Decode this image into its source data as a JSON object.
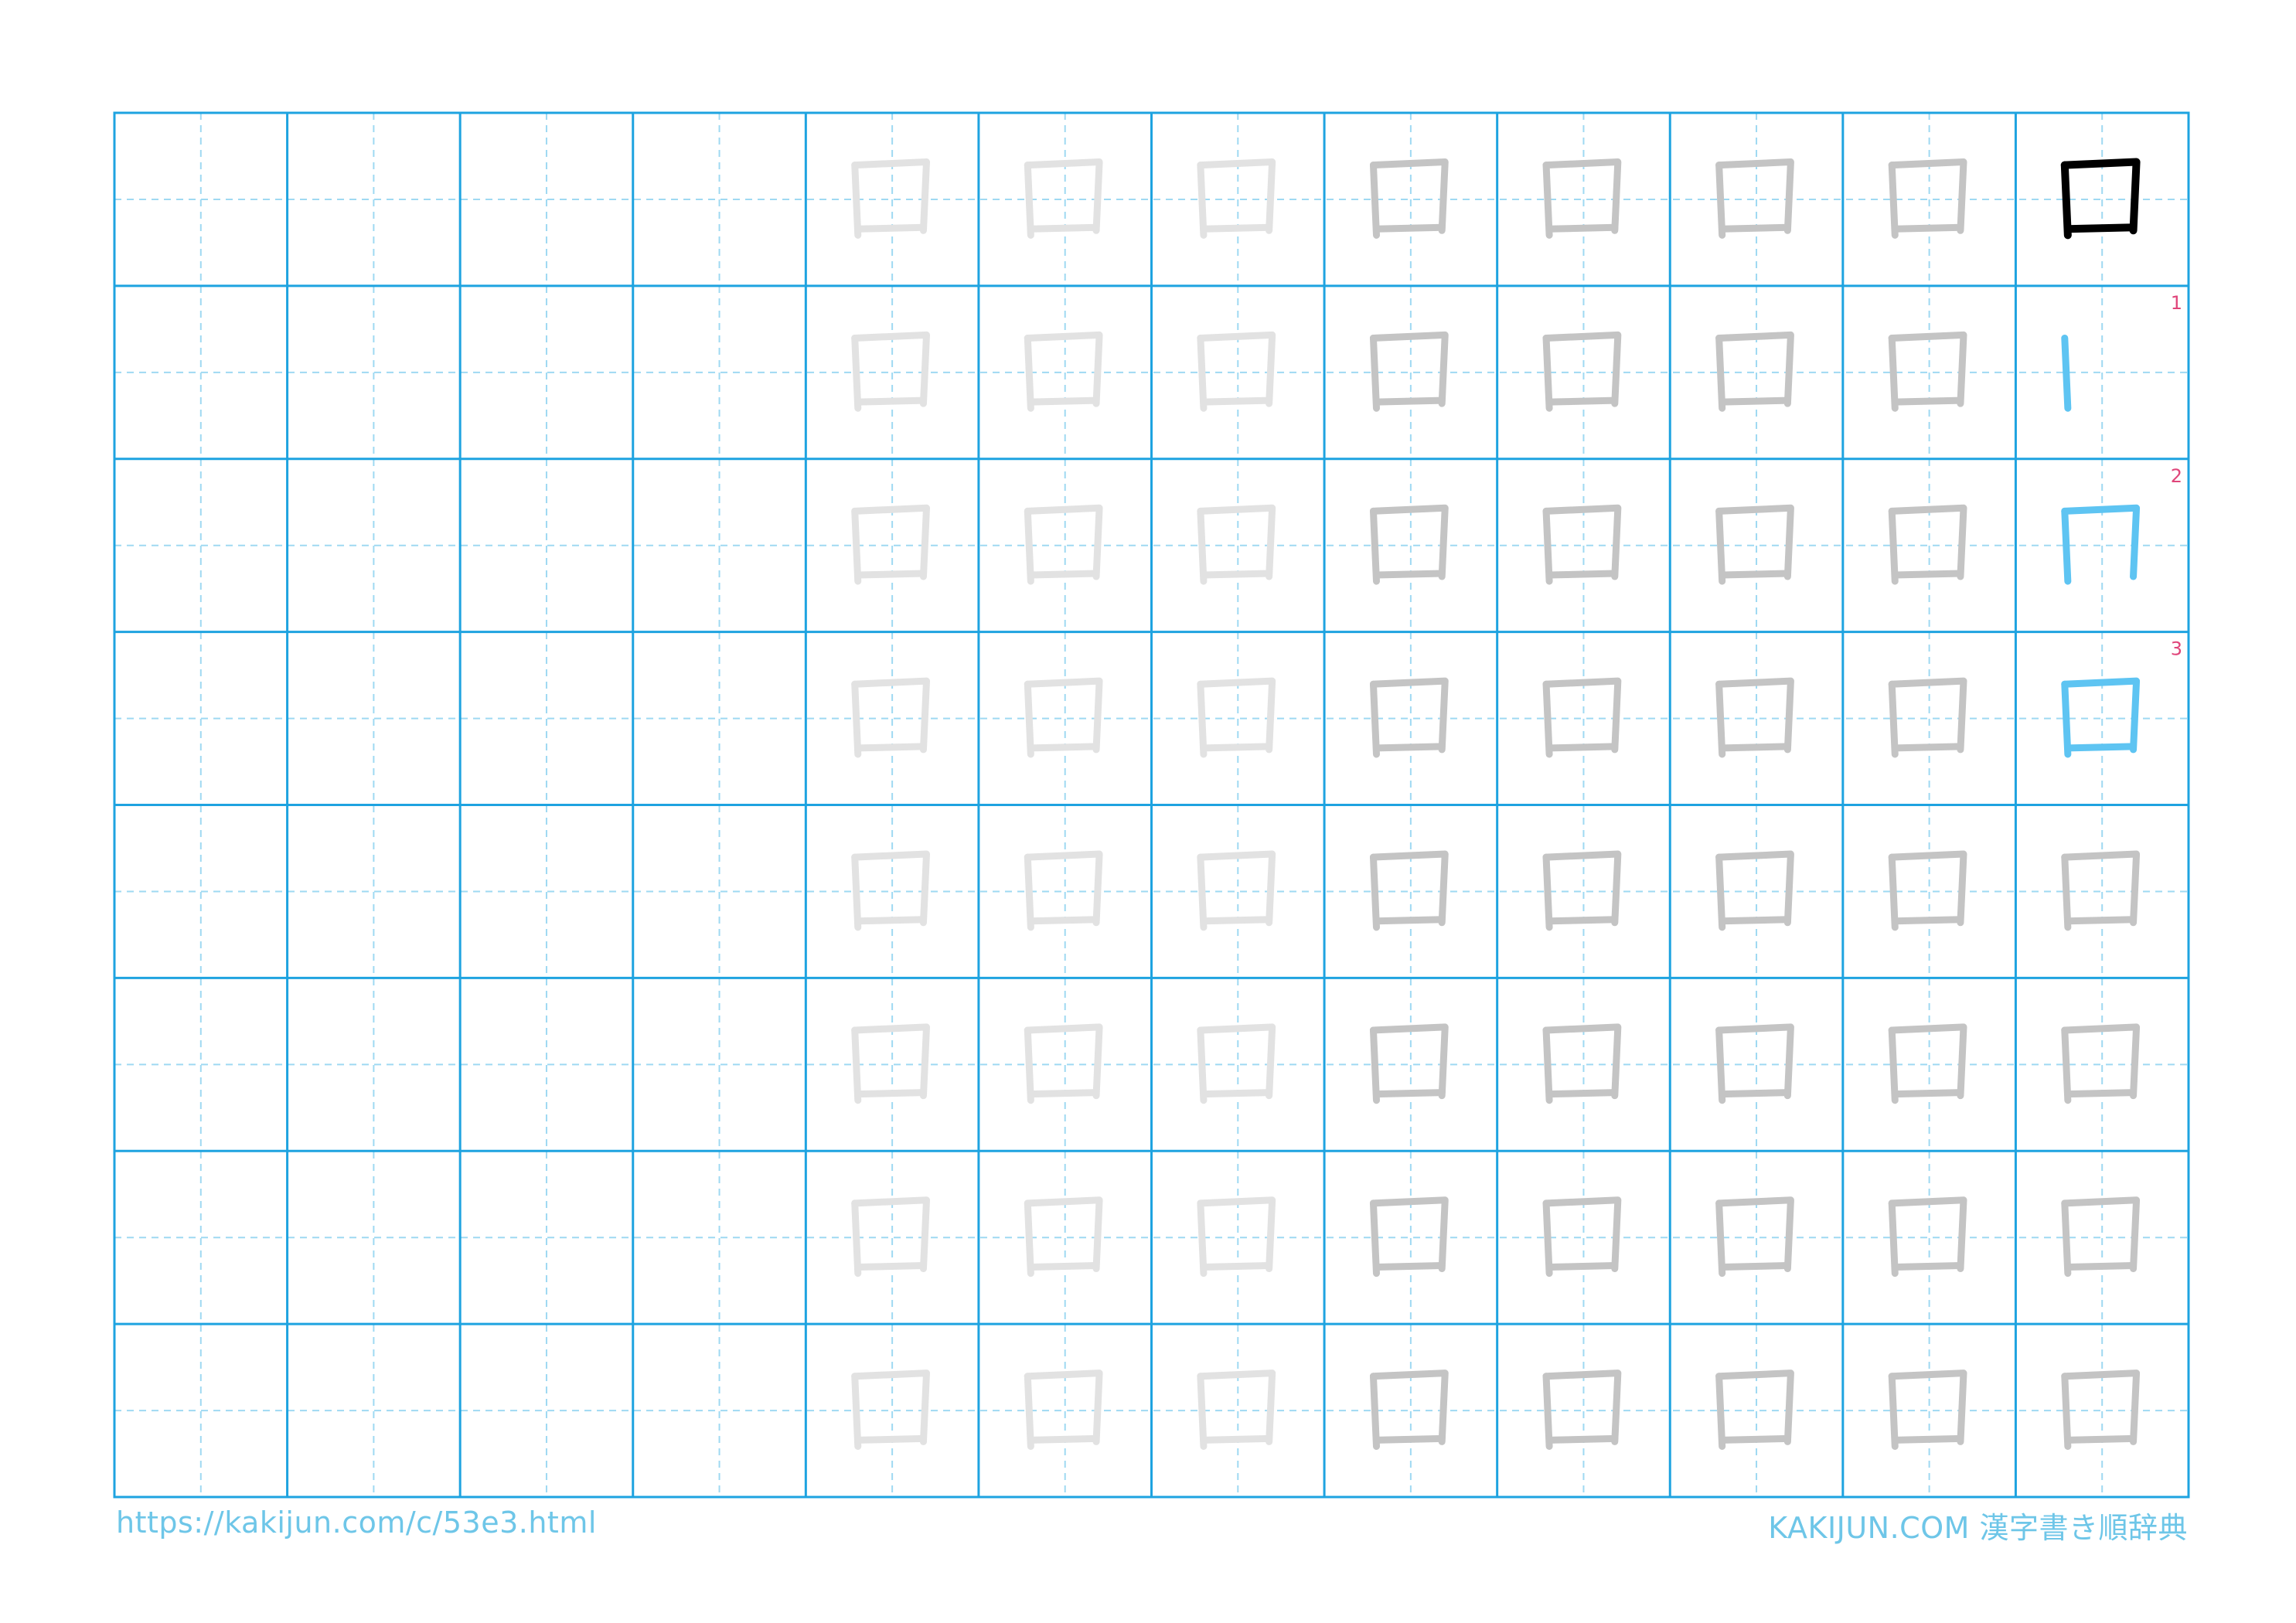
{
  "worksheet": {
    "kanji": "口",
    "columns": 12,
    "rows": 8,
    "stroke_numbers": [
      "1",
      "2",
      "3"
    ],
    "colors": {
      "grid": "#1ea3e0",
      "guide": "#9fd9f2",
      "model": "#000000",
      "stroke_step": "#5ec4f2",
      "stroke_number": "#e0457a",
      "trace_dark": "#c4c4c4",
      "trace_light": "#e2e2e2"
    }
  },
  "footer": {
    "url": "https://kakijun.com/c/53e3.html",
    "brand": "KAKIJUN.COM 漢字書き順辞典"
  }
}
